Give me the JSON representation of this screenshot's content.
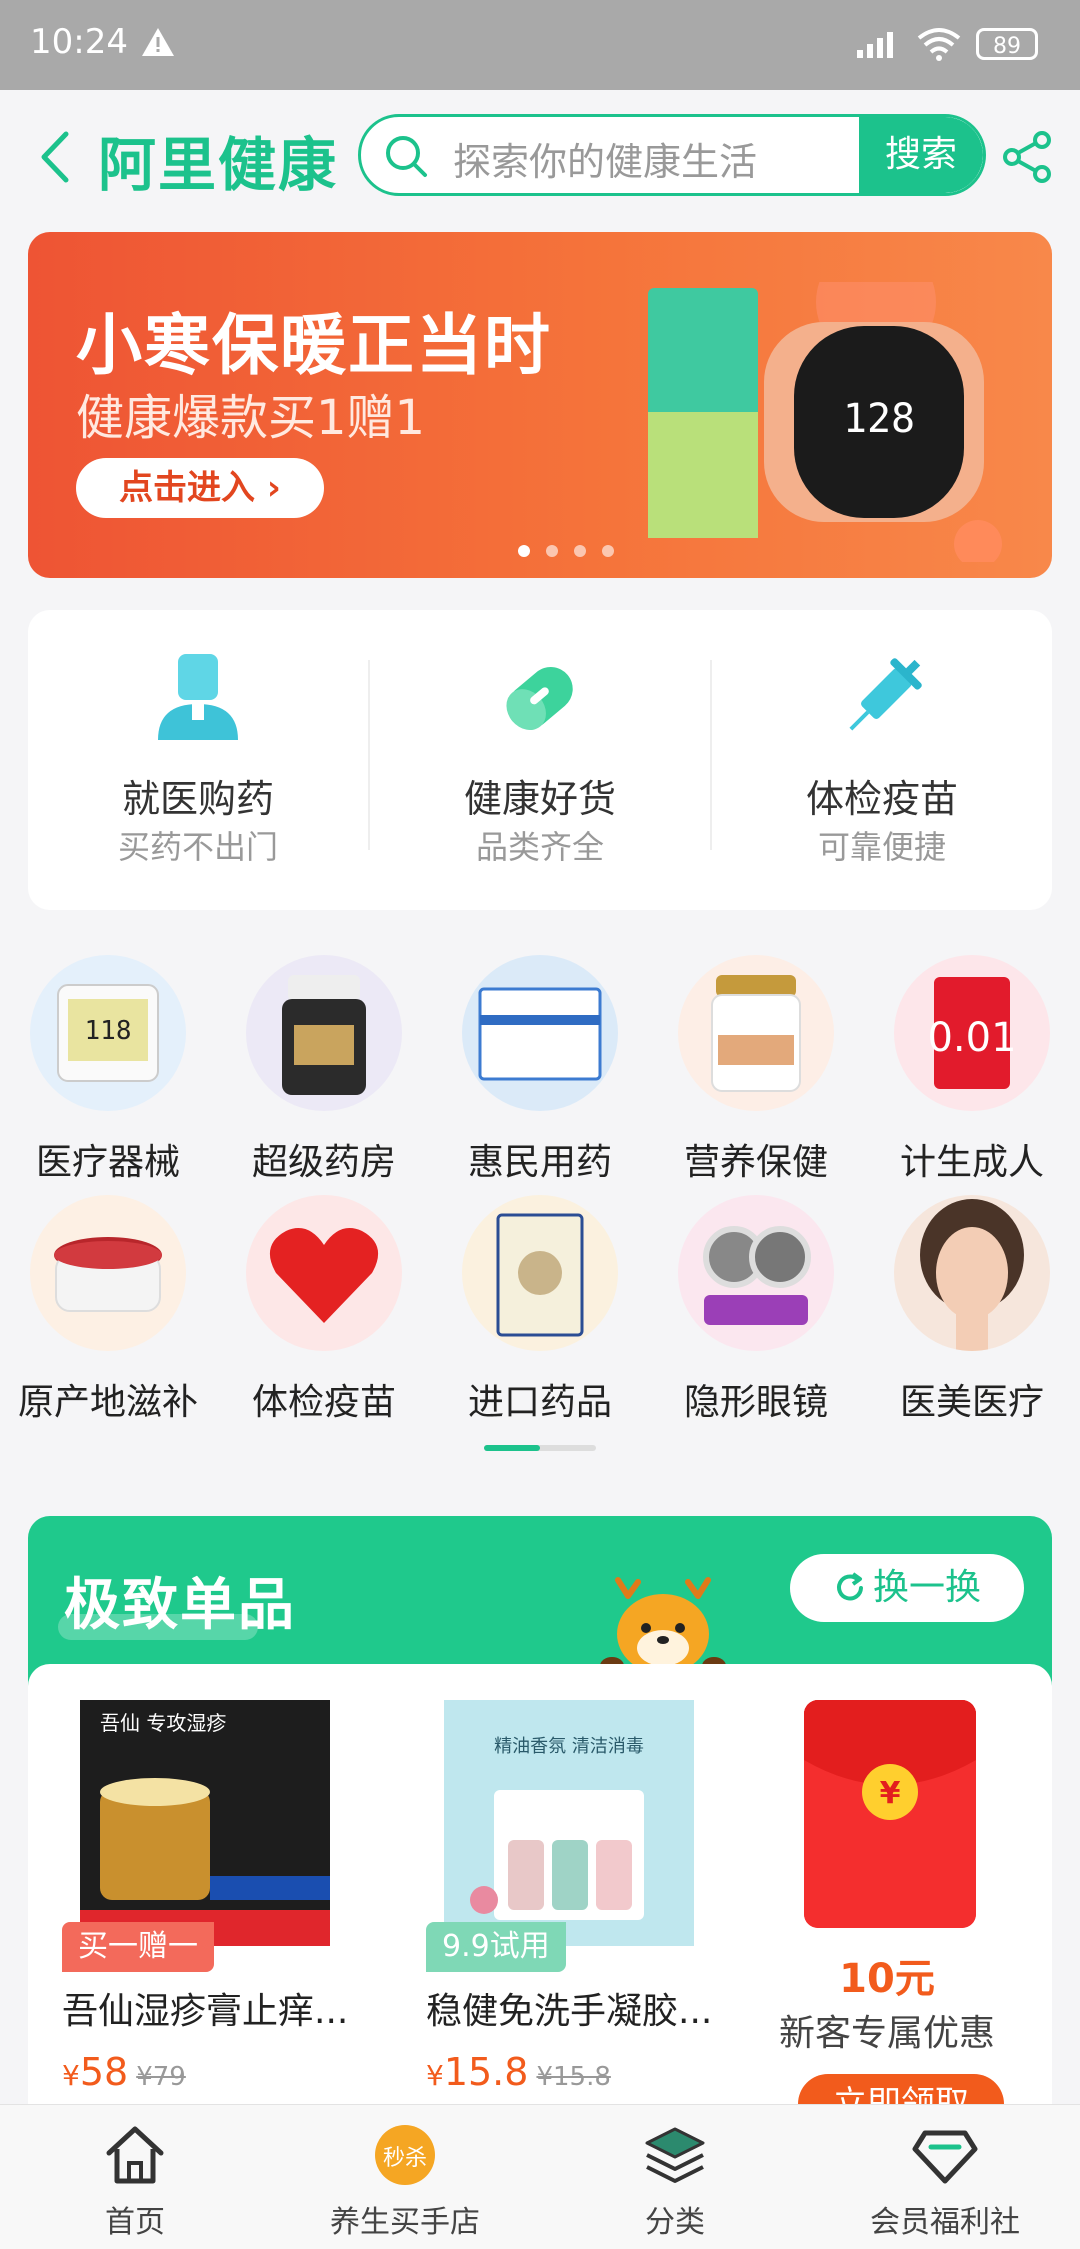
{
  "status_bar": {
    "time": "10:24",
    "battery": "89"
  },
  "header": {
    "app_name": "阿里健康",
    "search_placeholder": "探索你的健康生活",
    "search_button": "搜索"
  },
  "banner": {
    "title": "小寒保暖正当时",
    "subtitle": "健康爆款买1赠1",
    "cta": "点击进入",
    "slide_count": 4,
    "active_slide": 1
  },
  "services": [
    {
      "title": "就医购药",
      "subtitle": "买药不出门",
      "icon": "doctor-icon"
    },
    {
      "title": "健康好货",
      "subtitle": "品类齐全",
      "icon": "pill-icon"
    },
    {
      "title": "体检疫苗",
      "subtitle": "可靠便捷",
      "icon": "syringe-icon"
    }
  ],
  "categories": [
    {
      "label": "医疗器械"
    },
    {
      "label": "超级药房"
    },
    {
      "label": "惠民用药"
    },
    {
      "label": "营养保健"
    },
    {
      "label": "计生成人"
    },
    {
      "label": "原产地滋补"
    },
    {
      "label": "体检疫苗"
    },
    {
      "label": "进口药品"
    },
    {
      "label": "隐形眼镜"
    },
    {
      "label": "医美医疗"
    }
  ],
  "promo": {
    "title": "极致单品",
    "swap_button": "换一换",
    "products": [
      {
        "tag": "买一赠一",
        "name": "吾仙湿疹膏止痒...",
        "price": "58",
        "original_price": "¥79",
        "image_text": "吾仙 专攻湿疹"
      },
      {
        "tag": "9.9试用",
        "name": "稳健免洗手凝胶...",
        "price": "15.8",
        "original_price": "¥15.8",
        "image_text": "精油香氛 清洁消毒"
      }
    ],
    "coupon": {
      "amount": "10元",
      "description": "新客专属优惠",
      "button": "立即领取"
    }
  },
  "tabbar": [
    {
      "label": "首页",
      "icon": "home-icon"
    },
    {
      "label": "养生买手店",
      "icon": "flash-sale-icon",
      "badge": "秒杀"
    },
    {
      "label": "分类",
      "icon": "layers-icon"
    },
    {
      "label": "会员福利社",
      "icon": "member-icon"
    }
  ],
  "colors": {
    "brand": "#1cc28c",
    "price": "#f25b1c",
    "banner": "#ee5434"
  }
}
